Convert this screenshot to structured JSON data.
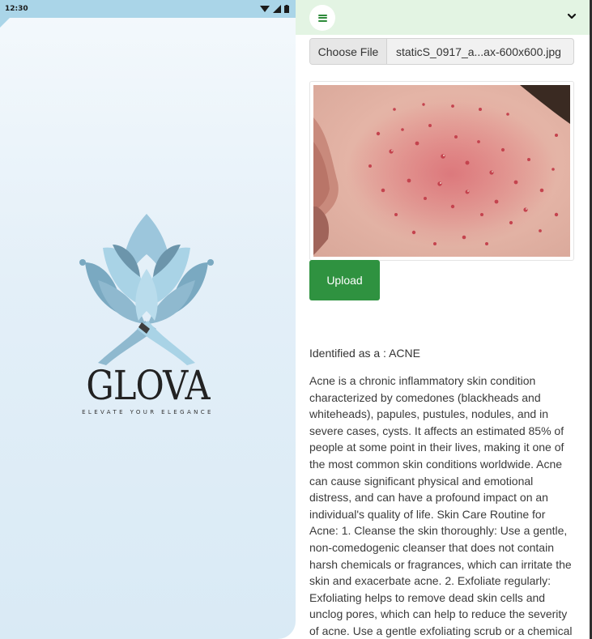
{
  "status_bar": {
    "time": "12:30",
    "icons": [
      "wifi-icon",
      "signal-icon",
      "battery-icon"
    ]
  },
  "brand": {
    "name": "GLOVA",
    "tagline": "ELEVATE YOUR ELEGANCE",
    "logo_icon": "lotus-logo-icon",
    "colors": {
      "petal_light": "#a9d3e6",
      "petal_mid": "#8fb9cf",
      "petal_dark": "#6c95ab",
      "background": "#e3eff8"
    }
  },
  "navbar": {
    "menu_icon": "hamburger-menu-icon",
    "dropdown_icon": "chevron-down-icon",
    "background": "#e3f4e3"
  },
  "upload_form": {
    "choose_file_label": "Choose File",
    "file_name": "staticS_0917_a...ax-600x600.jpg",
    "upload_label": "Upload",
    "upload_color": "#2f9240"
  },
  "result": {
    "label": "Identified as a : ACNE",
    "description": "Acne is a chronic inflammatory skin condition characterized by comedones (blackheads and whiteheads), papules, pustules, nodules, and in severe cases, cysts. It affects an estimated 85% of people at some point in their lives, making it one of the most common skin conditions worldwide. Acne can cause significant physical and emotional distress, and can have a profound impact on an individual's quality of life. Skin Care Routine for Acne: 1. Cleanse the skin thoroughly: Use a gentle, non-comedogenic cleanser that does not contain harsh chemicals or fragrances, which can irritate the skin and exacerbate acne. 2. Exfoliate regularly: Exfoliating helps to remove dead skin cells and unclog pores, which can help to reduce the severity of acne. Use a gentle exfoliating scrub or a chemical exfoliant containing"
  }
}
